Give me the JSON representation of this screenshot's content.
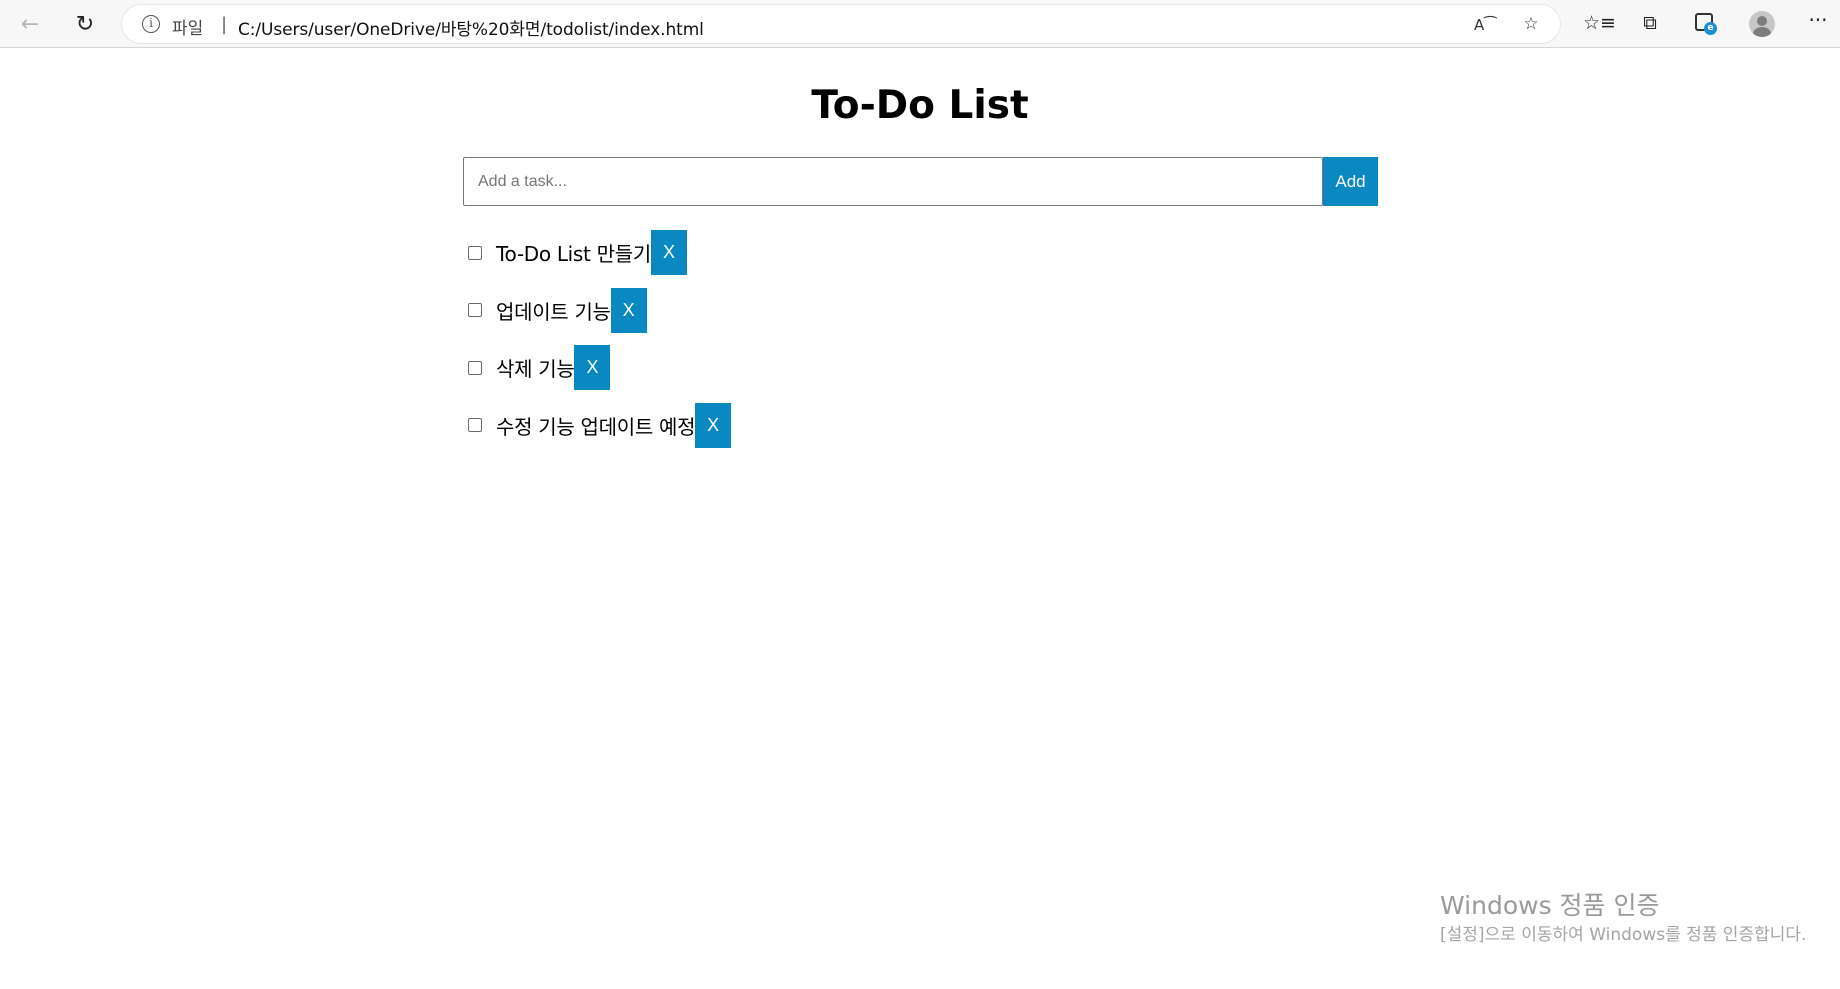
{
  "browser": {
    "back_icon": "arrow-left-icon",
    "refresh_icon": "refresh-icon",
    "address": {
      "info_icon": "info-icon",
      "scheme_label": "파일",
      "separator": "|",
      "url": "C:/Users/user/OneDrive/바탕%20화면/todolist/index.html"
    },
    "icons": [
      "read-aloud-icon",
      "add-favorite-icon",
      "favorites-icon",
      "collections-icon",
      "edge-icon",
      "profile-avatar",
      "more-menu-icon"
    ]
  },
  "app": {
    "title": "To-Do List",
    "input": {
      "placeholder": "Add a task...",
      "value": ""
    },
    "add_label": "Add",
    "tasks": [
      {
        "text": "To-Do List 만들기",
        "done": false,
        "delete_label": "X"
      },
      {
        "text": "업데이트 기능",
        "done": false,
        "delete_label": "X"
      },
      {
        "text": "삭제 기능",
        "done": false,
        "delete_label": "X"
      },
      {
        "text": "수정 기능 업데이트 예정",
        "done": false,
        "delete_label": "X"
      }
    ]
  },
  "watermark": {
    "title": "Windows 정품 인증",
    "subtitle": "[설정]으로 이동하여 Windows를 정품 인증합니다."
  },
  "colors": {
    "accent": "#0a88c2",
    "watermark": "#9a9a9a"
  }
}
